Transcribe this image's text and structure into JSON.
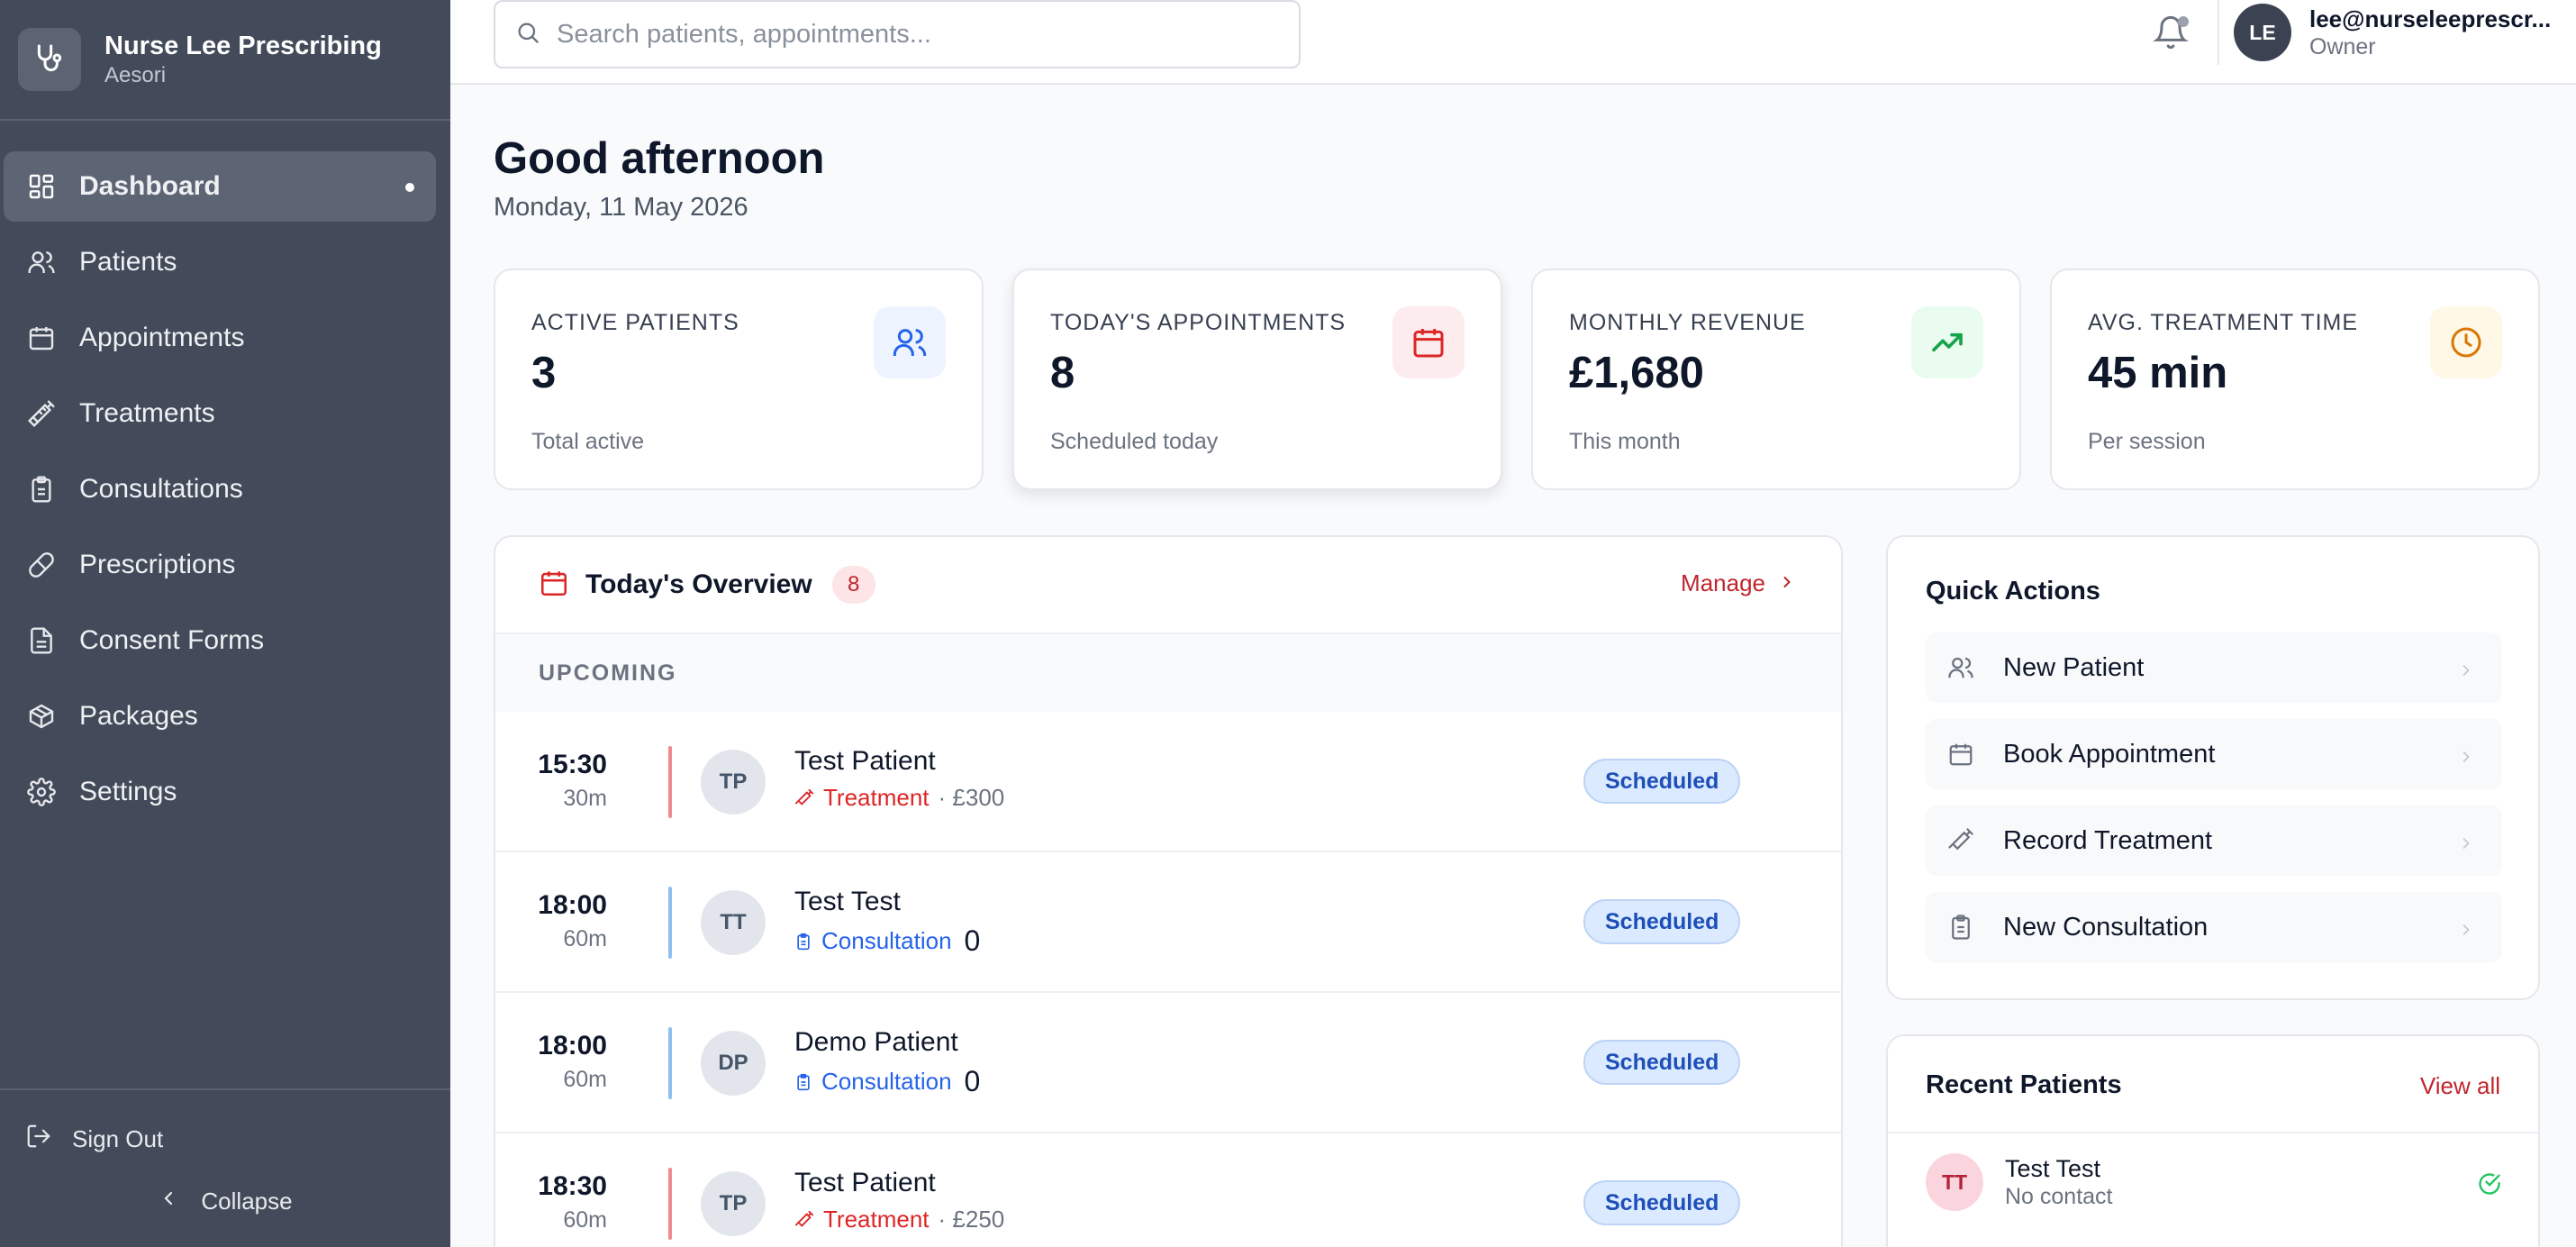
{
  "brand": {
    "title": "Nurse Lee Prescribing",
    "subtitle": "Aesori"
  },
  "nav": [
    {
      "label": "Dashboard",
      "icon": "dashboard-icon",
      "active": true
    },
    {
      "label": "Patients",
      "icon": "users-icon"
    },
    {
      "label": "Appointments",
      "icon": "calendar-icon"
    },
    {
      "label": "Treatments",
      "icon": "syringe-icon"
    },
    {
      "label": "Consultations",
      "icon": "clipboard-icon"
    },
    {
      "label": "Prescriptions",
      "icon": "pill-icon"
    },
    {
      "label": "Consent Forms",
      "icon": "document-icon"
    },
    {
      "label": "Packages",
      "icon": "package-icon"
    },
    {
      "label": "Settings",
      "icon": "gear-icon"
    }
  ],
  "sidebar_footer": {
    "sign_out": "Sign Out",
    "collapse": "Collapse"
  },
  "header": {
    "search_placeholder": "Search patients, appointments...",
    "user_initials": "LE",
    "user_email": "lee@nurseleeprescr...",
    "user_role": "Owner"
  },
  "greeting": {
    "title": "Good afternoon",
    "date": "Monday, 11 May 2026"
  },
  "stats": [
    {
      "label": "ACTIVE PATIENTS",
      "value": "3",
      "sub": "Total active",
      "icon": "users-icon",
      "color": "#2563eb",
      "bg": "#eef4ff"
    },
    {
      "label": "TODAY'S APPOINTMENTS",
      "value": "8",
      "sub": "Scheduled today",
      "icon": "calendar-icon",
      "color": "#dc2626",
      "bg": "#fdecee"
    },
    {
      "label": "MONTHLY REVENUE",
      "value": "£1,680",
      "sub": "This month",
      "icon": "trending-up-icon",
      "color": "#16a34a",
      "bg": "#eafbf0"
    },
    {
      "label": "AVG. TREATMENT TIME",
      "value": "45 min",
      "sub": "Per session",
      "icon": "clock-icon",
      "color": "#d97706",
      "bg": "#fff8e6"
    }
  ],
  "overview": {
    "title": "Today's Overview",
    "count": "8",
    "manage_label": "Manage",
    "section_label": "UPCOMING",
    "appointments": [
      {
        "time": "15:30",
        "duration": "30m",
        "initials": "TP",
        "name": "Test Patient",
        "type": "Treatment",
        "price": "· £300",
        "extra": "",
        "status": "Scheduled"
      },
      {
        "time": "18:00",
        "duration": "60m",
        "initials": "TT",
        "name": "Test Test",
        "type": "Consultation",
        "price": "",
        "extra": "0",
        "status": "Scheduled"
      },
      {
        "time": "18:00",
        "duration": "60m",
        "initials": "DP",
        "name": "Demo Patient",
        "type": "Consultation",
        "price": "",
        "extra": "0",
        "status": "Scheduled"
      },
      {
        "time": "18:30",
        "duration": "60m",
        "initials": "TP",
        "name": "Test Patient",
        "type": "Treatment",
        "price": "· £250",
        "extra": "",
        "status": "Scheduled"
      }
    ]
  },
  "quick_actions": {
    "title": "Quick Actions",
    "items": [
      "New Patient",
      "Book Appointment",
      "Record Treatment",
      "New Consultation"
    ]
  },
  "recent_patients": {
    "title": "Recent Patients",
    "view_all": "View all",
    "items": [
      {
        "initials": "TT",
        "name": "Test Test",
        "sub": "No contact"
      }
    ]
  },
  "colors": {
    "sidebar": "#434b5a",
    "accent_red": "#c0262d",
    "treatment": "#dc2626",
    "consultation": "#2563eb"
  }
}
